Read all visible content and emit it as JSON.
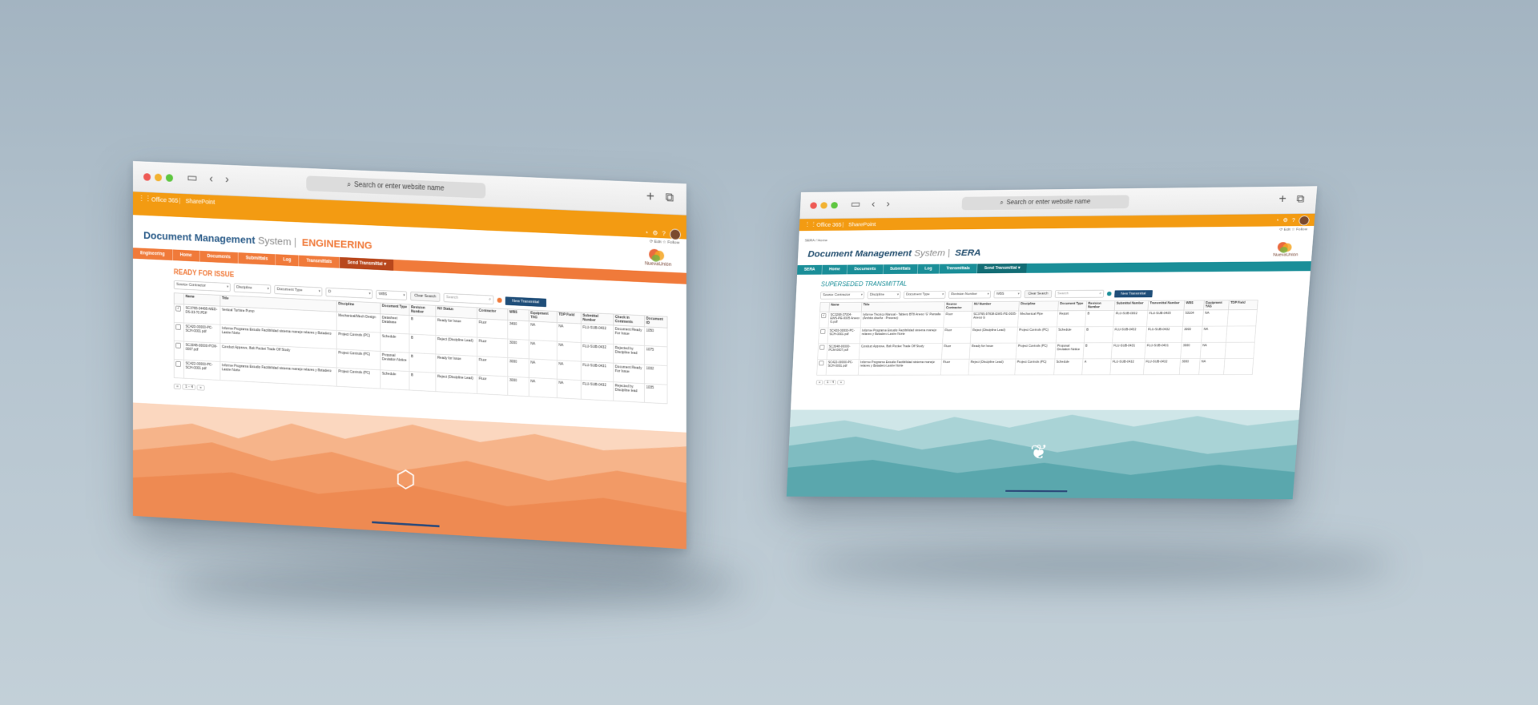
{
  "colors": {
    "orange_bar": "#f39b12",
    "eng_accent": "#f07a3a",
    "eng_title_blue": "#2c5d8a",
    "sera_teal": "#1a8e98",
    "sera_title": "#234e6e",
    "new_btn": "#1f4e79"
  },
  "browser": {
    "address_placeholder": "Search or enter website name",
    "plus_icon": "+",
    "tabs_icon": "⧉"
  },
  "office": {
    "app_name": "Office 365",
    "product": "SharePoint"
  },
  "engineering": {
    "utils": "⟳ Edit  ☆ Follow",
    "title_main": "Document Management",
    "title_system": "System",
    "title_area": "ENGINEERING",
    "logo_text": "NuevaUnión",
    "nav": [
      "Engineering",
      "Home",
      "Documents",
      "Submittals",
      "Log",
      "Transmittals",
      "Send Transmittal ▾"
    ],
    "section_title": "READY FOR ISSUE",
    "filters": [
      "Source Contractor",
      "Discipline",
      "Document Type",
      "D",
      "WBS"
    ],
    "clear_search": "Clear Search",
    "search_placeholder": "Search",
    "new_transmittal": "New Transmittal",
    "columns": [
      "Name",
      "Title",
      "Discipline",
      "Document Type",
      "Revision Number",
      "NU Status",
      "Contractor",
      "WBS",
      "Equipment TAG",
      "TDP Field",
      "Submittal Number",
      "Check in Comments",
      "Document ID"
    ],
    "rows": [
      {
        "checked": "✓",
        "name": "SC3765-04495-MED-DS-33-70.PDF",
        "title": "Vertical Turbine Pump",
        "discipline": "Mechanical/Mech Design",
        "doctype": "Datasheet Database",
        "rev": "B",
        "status": "Ready for Issue",
        "contractor": "Fluor",
        "wbs": "3400",
        "tag": "NA",
        "tdp": "NA",
        "submittal": "FLU-SUB-0402",
        "comments": "Document Ready For Issue",
        "docid": "1050"
      },
      {
        "checked": "",
        "name": "SC420-00000-PC-SCH-0001.pdf",
        "title": "Informe Programa Estudio Factibilidad sistema manejo relaves y Botadero Lastre Norte",
        "discipline": "Project Controls (PC)",
        "doctype": "Schedule",
        "rev": "B",
        "status": "Reject (Discipline Lead)",
        "contractor": "Fluor",
        "wbs": "3000",
        "tag": "NA",
        "tdp": "NA",
        "submittal": "FLU-SUB-0432",
        "comments": "Rejected by Discipline lead",
        "docid": "1075"
      },
      {
        "checked": "",
        "name": "SC3048-00000-PCM-0007.pdf",
        "title": "Conduct Approve, Bolt Pocket Trade Off Study",
        "discipline": "Project Controls (PC)",
        "doctype": "Proposal Deviation Notice",
        "rev": "B",
        "status": "Ready for Issue",
        "contractor": "Fluor",
        "wbs": "3000",
        "tag": "NA",
        "tdp": "NA",
        "submittal": "FLU-SUB-0431",
        "comments": "Document Ready For Issue",
        "docid": "1032"
      },
      {
        "checked": "",
        "name": "SC422-00000-PC-SCH-0001.pdf",
        "title": "Informe Programa Estudio Factibilidad sistema manejo relaves y Botadero Lastre Norte",
        "discipline": "Project Controls (PC)",
        "doctype": "Schedule",
        "rev": "B",
        "status": "Reject (Discipline Lead)",
        "contractor": "Fluor",
        "wbs": "3000",
        "tag": "NA",
        "tdp": "NA",
        "submittal": "FLU-SUB-0432",
        "comments": "Rejected by Discipline lead",
        "docid": "1035"
      }
    ],
    "pager": {
      "prev": "«",
      "range": "1 - 4",
      "next": "»"
    },
    "footer_icon": "⬡"
  },
  "sera": {
    "utils": "⟳ Edit  ☆ Follow",
    "breadcrumb": "SERA / Home",
    "title_main": "Document Management",
    "title_system": "System",
    "title_area": "SERA",
    "logo_text": "NuevaUnión",
    "nav": [
      "SERA",
      "Home",
      "Documents",
      "Submittals",
      "Log",
      "Transmittals",
      "Send Transmittal ▾"
    ],
    "section_title": "SUPERSEDED TRANSMITTAL",
    "filters": [
      "Source Contractor",
      "Discipline",
      "Document Type",
      "Revision Number",
      "WBS"
    ],
    "clear_search": "Clear Search",
    "search_placeholder": "Search",
    "new_transmittal": "New Transmittal",
    "columns": [
      "Name",
      "Title",
      "Source Contractor",
      "NU Number",
      "Discipline",
      "Document Type",
      "Revision Number",
      "Submittal Number",
      "Transmittal Number",
      "WBS",
      "Equipment TAG",
      "TDP Field"
    ],
    "rows": [
      {
        "checked": "✓",
        "name": "SC3268-37004-EWS-PE-0005 Anexo G.pdf",
        "title": "Informe Técnico Manual - Tablero BT8 Anexo 'G' Pantalla (Ámbito diseño - Proceso)",
        "source": "Fluor",
        "nu": "SC3765-97838-EWS-PE-0005-Anexo G",
        "discipline": "Mechanical Pipe",
        "doctype": "Report",
        "rev": "B",
        "submittal": "FLU-SUB-0002",
        "transmittal": "FLU-SUB-0405",
        "wbs": "53104",
        "tag": "NA",
        "tdp": ""
      },
      {
        "checked": "",
        "name": "SC420-00000-PC-SCH-0001.pdf",
        "title": "Informe Programa Estudio Factibilidad sistema manejo relaves y Botadero Lastre Norte",
        "source": "Fluor",
        "nu": "Reject (Discipline Lead)",
        "discipline": "Project Controls (PC)",
        "doctype": "Schedule",
        "rev": "B",
        "submittal": "FLU-SUB-0432",
        "transmittal": "FLU-SUB-0432",
        "wbs": "3000",
        "tag": "NA",
        "tdp": ""
      },
      {
        "checked": "",
        "name": "SC3048-00000-PCM-0007.pdf",
        "title": "Conduct Approve, Bolt Pocket Trade Off Study",
        "source": "Fluor",
        "nu": "Ready for Issue",
        "discipline": "Project Controls (PC)",
        "doctype": "Proposal Deviation Notice",
        "rev": "B",
        "submittal": "FLU-SUB-0431",
        "transmittal": "FLU-SUB-0431",
        "wbs": "3000",
        "tag": "NA",
        "tdp": ""
      },
      {
        "checked": "",
        "name": "SC422-00000-PC-SCH-0001.pdf",
        "title": "Informe Programa Estudio Factibilidad sistema manejo relaves y Botadero Lastre Norte",
        "source": "Fluor",
        "nu": "Reject (Discipline Lead)",
        "discipline": "Project Controls (PC)",
        "doctype": "Schedule",
        "rev": "A",
        "submittal": "FLU-SUB-0432",
        "transmittal": "FLU-SUB-0432",
        "wbs": "3000",
        "tag": "NA",
        "tdp": ""
      }
    ],
    "pager": {
      "prev": "«",
      "range": "1 - 4",
      "next": "»"
    },
    "footer_icon": "❦"
  }
}
